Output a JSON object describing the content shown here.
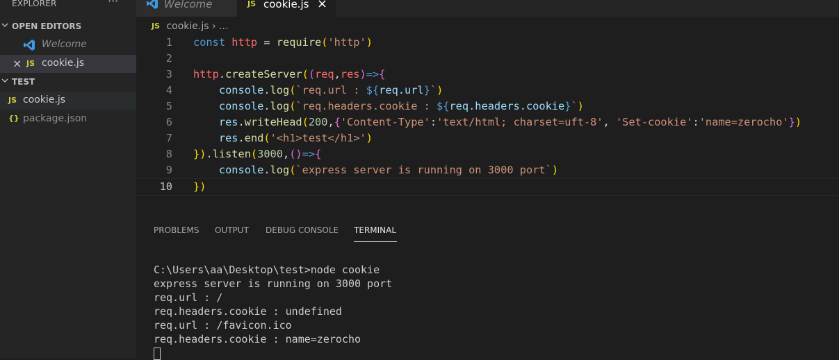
{
  "explorer": {
    "title": "EXPLORER",
    "more": "···",
    "open_editors": {
      "label": "OPEN EDITORS",
      "items": [
        {
          "name": "Welcome"
        },
        {
          "close": "×",
          "badge": "JS",
          "name": "cookie.js"
        }
      ]
    },
    "folder": {
      "label": "TEST",
      "items": [
        {
          "badge": "JS",
          "name": "cookie.js"
        },
        {
          "badge": "{}",
          "name": "package.json"
        }
      ]
    }
  },
  "tabs": [
    {
      "label": "Welcome",
      "active": false
    },
    {
      "badge": "JS",
      "label": "cookie.js",
      "close": "×",
      "active": true
    }
  ],
  "breadcrumb": {
    "badge": "JS",
    "file": "cookie.js",
    "sep": "›",
    "rest": "..."
  },
  "editor": {
    "line_numbers": [
      "1",
      "2",
      "3",
      "4",
      "5",
      "6",
      "7",
      "8",
      "9",
      "10"
    ],
    "lines": [
      "const http = require('http')",
      "",
      "http.createServer((req,res)=>{",
      "    console.log(`req.url : ${req.url}`)",
      "    console.log(`req.headers.cookie : ${req.headers.cookie}`)",
      "    res.writeHead(200,{'Content-Type':'text/html; charset=uft-8', 'Set-cookie':'name=zerocho'})",
      "    res.end('<h1>test</h1>')",
      "}).listen(3000,()=>{",
      "    console.log(`express server is running on 3000 port`)",
      "})"
    ],
    "current_line": 10
  },
  "panel": {
    "tabs": [
      "PROBLEMS",
      "OUTPUT",
      "DEBUG CONSOLE",
      "TERMINAL"
    ],
    "active_tab": "TERMINAL",
    "terminal_lines": [
      "C:\\Users\\aa\\Desktop\\test>node cookie",
      "express server is running on 3000 port",
      "req.url : /",
      "req.headers.cookie : undefined",
      "req.url : /favicon.ico",
      "req.headers.cookie : name=zerocho"
    ]
  },
  "colors": {
    "accent": "#007acc",
    "js_badge": "#cbcb41",
    "json_badge": "#cbcb41"
  }
}
